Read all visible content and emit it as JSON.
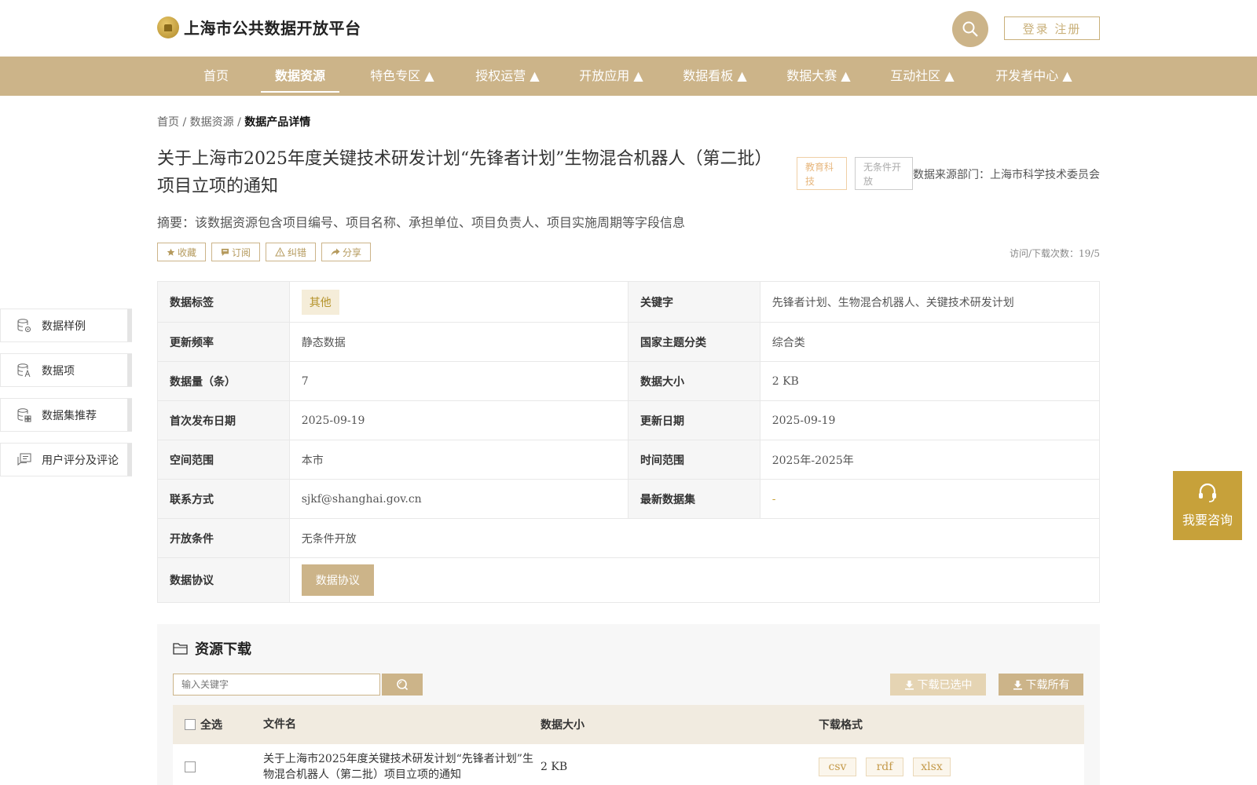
{
  "header": {
    "site_title": "上海市公共数据开放平台",
    "login_label": "登录 注册"
  },
  "nav": {
    "items": [
      {
        "label": "首页"
      },
      {
        "label": "数据资源"
      },
      {
        "label": "特色专区 ▲"
      },
      {
        "label": "授权运营 ▲"
      },
      {
        "label": "开放应用 ▲"
      },
      {
        "label": "数据看板 ▲"
      },
      {
        "label": "数据大赛 ▲"
      },
      {
        "label": "互动社区 ▲"
      },
      {
        "label": "开发者中心 ▲"
      }
    ]
  },
  "breadcrumb": {
    "home": "首页",
    "sep1": " / ",
    "resources": "数据资源",
    "sep2": " / ",
    "current": "数据产品详情"
  },
  "product": {
    "title": "关于上海市2025年度关键技术研发计划“先锋者计划”生物混合机器人（第二批）项目立项的通知",
    "tag_category": "教育科技",
    "tag_open": "无条件开放",
    "department": "数据来源部门：上海市科学技术委员会",
    "summary": "摘要：该数据资源包含项目编号、项目名称、承担单位、项目负责人、项目实施周期等字段信息",
    "visits": "访问/下载次数：19/5"
  },
  "actions": {
    "favorite": "收藏",
    "subscribe": "订阅",
    "report": "纠错",
    "share": "分享"
  },
  "sidenav": {
    "items": [
      {
        "label": "数据样例"
      },
      {
        "label": "数据项"
      },
      {
        "label": "数据集推荐"
      },
      {
        "label": "用户评分及评论"
      }
    ]
  },
  "info": {
    "tag_label": "数据标签",
    "tag_value": "其他",
    "keyword_label": "关键字",
    "keyword_value": "先锋者计划、生物混合机器人、关键技术研发计划",
    "freq_label": "更新频率",
    "freq_value": "静态数据",
    "theme_label": "国家主题分类",
    "theme_value": "综合类",
    "count_label": "数据量（条）",
    "count_value": "7",
    "size_label": "数据大小",
    "size_value": "2 KB",
    "first_label": "首次发布日期",
    "first_value": "2025-09-19",
    "update_label": "更新日期",
    "update_value": "2025-09-19",
    "space_label": "空间范围",
    "space_value": "本市",
    "time_label": "时间范围",
    "time_value": "2025年-2025年",
    "contact_label": "联系方式",
    "contact_value": "sjkf@shanghai.gov.cn",
    "latest_label": "最新数据集",
    "latest_value": "-",
    "cond_label": "开放条件",
    "cond_value": "无条件开放",
    "agreement_label": "数据协议",
    "agreement_button": "数据协议"
  },
  "consult": {
    "label": "我要咨询"
  },
  "resource": {
    "title": "资源下载",
    "search_placeholder": "输入关键字",
    "download_selected": "下载已选中",
    "download_all": "下载所有",
    "headers": {
      "select_all": "全选",
      "filename": "文件名",
      "size": "数据大小",
      "format": "下载格式"
    },
    "rows": [
      {
        "filename": "关于上海市2025年度关键技术研发计划“先锋者计划”生物混合机器人（第二批）项目立项的通知",
        "size": "2 KB",
        "formats": [
          "csv",
          "rdf",
          "xlsx"
        ]
      }
    ]
  }
}
